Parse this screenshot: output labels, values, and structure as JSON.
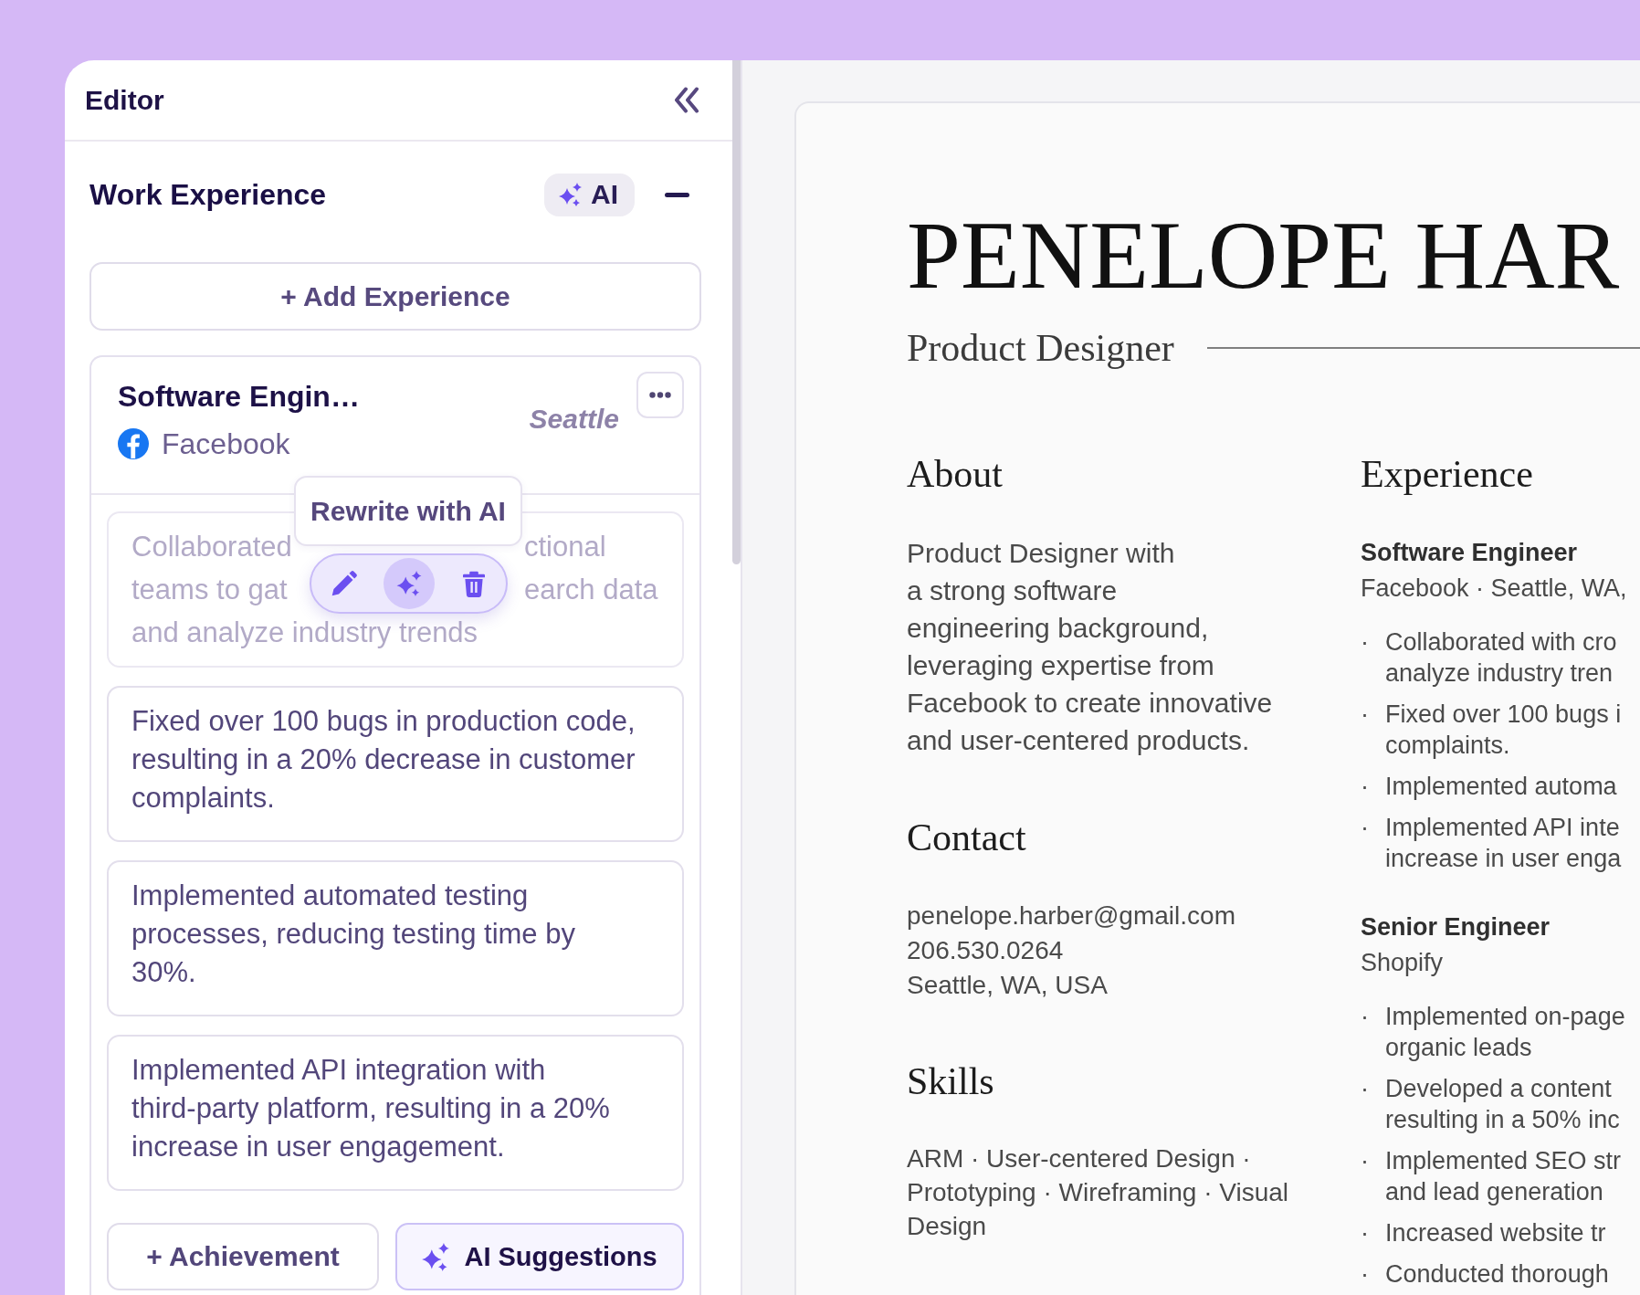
{
  "editor": {
    "title": "Editor"
  },
  "section": {
    "title": "Work Experience",
    "ai_label": "AI",
    "expanded": true
  },
  "add_button": "+ Add Experience",
  "entry": {
    "title": "Software Engin…",
    "company": "Facebook",
    "location": "Seattle",
    "achievements": [
      {
        "dimmed": true,
        "lines": [
          [
            "Collaborated",
            "ctional"
          ],
          [
            "teams to gat",
            "earch data"
          ],
          [
            "and analyze industry trends"
          ]
        ],
        "tooltip": "Rewrite with AI",
        "toolbar": [
          {
            "kind": "edit",
            "selected": false
          },
          {
            "kind": "rewrite",
            "selected": true
          },
          {
            "kind": "delete",
            "selected": false
          }
        ]
      },
      {
        "dimmed": false,
        "text": "Fixed over 100 bugs in production code, resulting in a 20% decrease in customer complaints."
      },
      {
        "dimmed": false,
        "text": "Implemented automated testing processes, reducing testing time by 30%."
      },
      {
        "dimmed": false,
        "text": "Implemented API integration with third-party platform, resulting in a 20% increase in user engagement."
      }
    ],
    "add_achievement": "+ Achievement",
    "ai_suggestions": "AI Suggestions"
  },
  "resume": {
    "name": "PENELOPE HAR",
    "role": "Product Designer",
    "about": {
      "heading": "About",
      "lines": [
        "Product Designer with",
        "a strong software",
        "engineering background,",
        "leveraging expertise from",
        "Facebook to create innovative",
        "and user-centered products."
      ]
    },
    "contact": {
      "heading": "Contact",
      "lines": [
        "penelope.harber@gmail.com",
        "206.530.0264",
        "Seattle, WA, USA"
      ]
    },
    "skills": {
      "heading": "Skills",
      "text": "ARM · User-centered Design · Prototyping · Wireframing · Visual Design"
    },
    "experience": {
      "heading": "Experience",
      "jobs": [
        {
          "title": "Software Engineer",
          "meta": "Facebook · Seattle, WA,",
          "bullets": [
            {
              "marker": "·",
              "lines": [
                "Collaborated with cro",
                "analyze industry tren"
              ]
            },
            {
              "marker": "·",
              "lines": [
                "Fixed over 100 bugs i",
                "complaints."
              ]
            },
            {
              "marker": "·",
              "lines": [
                "Implemented automa"
              ]
            },
            {
              "marker": "·",
              "lines": [
                "Implemented API inte",
                "increase in user enga"
              ]
            }
          ]
        },
        {
          "title": "Senior Engineer",
          "meta": "Shopify",
          "bullets": [
            {
              "marker": "·",
              "lines": [
                "Implemented on-page",
                "organic leads"
              ]
            },
            {
              "marker": "·",
              "lines": [
                "Developed a content",
                "resulting in a 50% inc"
              ]
            },
            {
              "marker": "·",
              "lines": [
                "Implemented SEO str",
                "and lead generation"
              ]
            },
            {
              "marker": "·",
              "lines": [
                "Increased website tr"
              ]
            },
            {
              "marker": "·",
              "lines": [
                "Conducted thorough"
              ]
            }
          ]
        }
      ]
    }
  }
}
